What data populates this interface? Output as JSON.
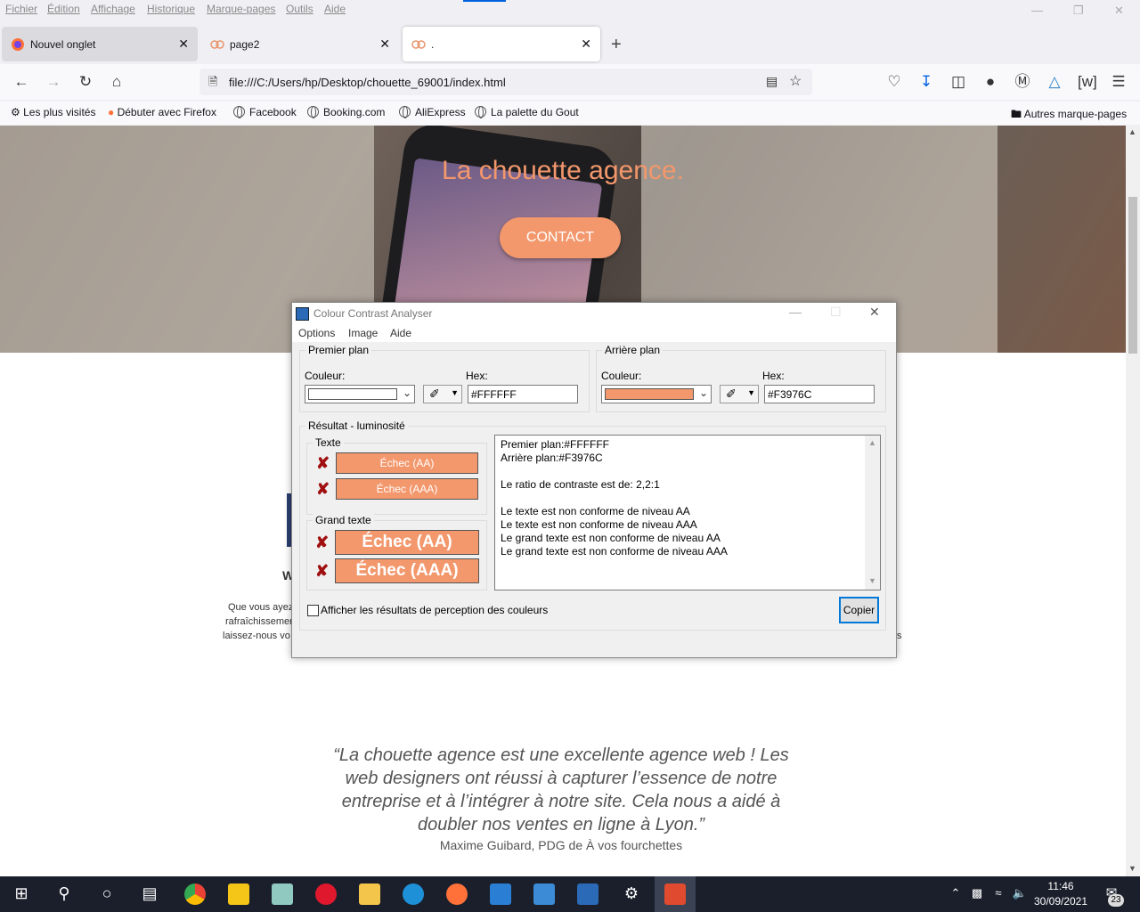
{
  "menubar": {
    "items": [
      "Fichier",
      "Édition",
      "Affichage",
      "Historique",
      "Marque-pages",
      "Outils",
      "Aide"
    ]
  },
  "tabs": [
    {
      "label": "Nouvel onglet",
      "icon": "firefox-icon"
    },
    {
      "label": "page2",
      "icon": "owl-icon"
    },
    {
      "label": ".",
      "icon": "owl-icon"
    }
  ],
  "navbar": {
    "url": "file:///C:/Users/hp/Desktop/chouette_69001/index.html"
  },
  "bookmarks": [
    {
      "label": "Les plus visités",
      "icon": "gear-icon"
    },
    {
      "label": "Débuter avec Firefox",
      "icon": "firefox-icon"
    },
    {
      "label": "Facebook",
      "icon": "globe-icon"
    },
    {
      "label": "Booking.com",
      "icon": "globe-icon"
    },
    {
      "label": "AliExpress",
      "icon": "globe-icon"
    },
    {
      "label": "La palette du Gout",
      "icon": "globe-icon"
    }
  ],
  "bookmarks_other": "Autres marque-pages",
  "page": {
    "hero_title": "La chouette agence.",
    "contact_label": "CONTACT",
    "fragments": {
      "w": "W",
      "line1": "Que vous ayez",
      "line2": "rafraîchissemen",
      "line3": "laissez-nous vo",
      "s": "s"
    },
    "quote": "“La chouette agence est une excellente agence web ! Les web designers ont réussi à capturer l’essence de notre entreprise et à l’intégrer à notre site. Cela nous a aidé à doubler nos ventes en ligne à Lyon.”",
    "quote_author": "Maxime Guibard, PDG de À vos fourchettes",
    "accent_color": "#F3976C"
  },
  "dialog": {
    "title": "Colour Contrast Analyser",
    "menu": [
      "Options",
      "Image",
      "Aide"
    ],
    "foreground": {
      "group_label": "Premier plan",
      "colour_label": "Couleur:",
      "hex_label": "Hex:",
      "hex_value": "#FFFFFF",
      "swatch_color": "#FFFFFF"
    },
    "background": {
      "group_label": "Arrière plan",
      "colour_label": "Couleur:",
      "hex_label": "Hex:",
      "hex_value": "#F3976C",
      "swatch_color": "#F3976C"
    },
    "result_group_label": "Résultat - luminosité",
    "text_group_label": "Texte",
    "large_text_group_label": "Grand texte",
    "text_results": [
      "Échec (AA)",
      "Échec (AAA)"
    ],
    "large_text_results": [
      "Échec (AA)",
      "Échec (AAA)"
    ],
    "result_lines": [
      "Premier plan:#FFFFFF",
      "Arrière plan:#F3976C",
      "",
      "Le ratio de contraste est de: 2,2:1",
      "",
      "Le texte est non conforme de niveau AA",
      "Le texte est non conforme de niveau AAA",
      "Le grand texte est non conforme de niveau AA",
      "Le grand texte est non conforme de niveau AAA"
    ],
    "perception_label": "Afficher les résultats de perception des couleurs",
    "perception_checked": false,
    "copy_label": "Copier"
  },
  "taskbar": {
    "time": "11:46",
    "date": "30/09/2021",
    "notification_count": "23"
  }
}
